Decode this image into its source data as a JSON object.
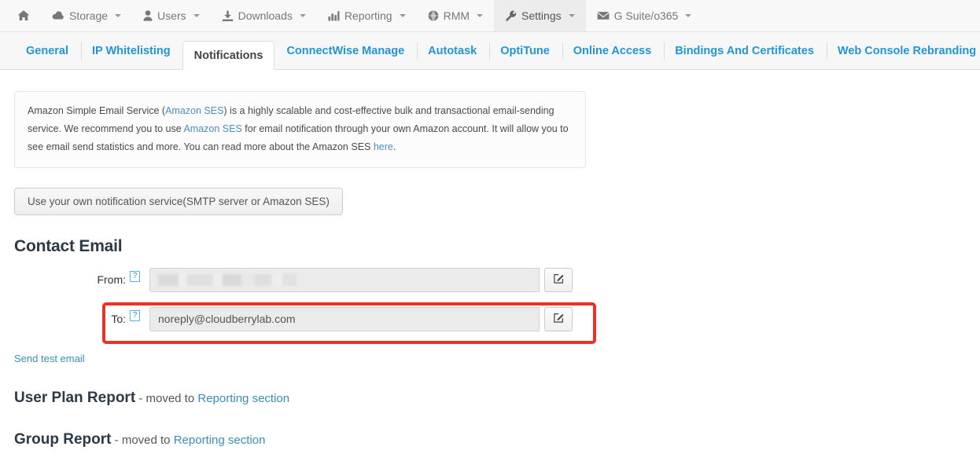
{
  "navbar": {
    "home_icon": "home-icon",
    "items": [
      {
        "label": "Storage",
        "icon": "cloud-icon",
        "caret": true,
        "active": false
      },
      {
        "label": "Users",
        "icon": "user-icon",
        "caret": true,
        "active": false
      },
      {
        "label": "Downloads",
        "icon": "download-icon",
        "caret": true,
        "active": false
      },
      {
        "label": "Reporting",
        "icon": "bar-chart-icon",
        "caret": true,
        "active": false
      },
      {
        "label": "RMM",
        "icon": "globe-icon",
        "caret": true,
        "active": false
      },
      {
        "label": "Settings",
        "icon": "wrench-icon",
        "caret": true,
        "active": true
      },
      {
        "label": "G Suite/o365",
        "icon": "envelope-icon",
        "caret": true,
        "active": false
      }
    ]
  },
  "tabs": [
    {
      "label": "General",
      "active": false
    },
    {
      "label": "IP Whitelisting",
      "active": false
    },
    {
      "label": "Notifications",
      "active": true
    },
    {
      "label": "ConnectWise Manage",
      "active": false
    },
    {
      "label": "Autotask",
      "active": false
    },
    {
      "label": "OptiTune",
      "active": false
    },
    {
      "label": "Online Access",
      "active": false
    },
    {
      "label": "Bindings And Certificates",
      "active": false
    },
    {
      "label": "Web Console Rebranding",
      "active": false
    }
  ],
  "alert": {
    "part1": "Amazon Simple Email Service (",
    "link1": "Amazon SES",
    "part2": ") is a highly scalable and cost-effective bulk and transactional email-sending service. We recommend you to use ",
    "link2": "Amazon SES",
    "part3": " for email notification through your own Amazon account. It will allow you to see email send statistics and more. You can read more about the Amazon SES ",
    "link3": "here",
    "part4": "."
  },
  "own_service_button": "Use your own notification service(SMTP server or Amazon SES)",
  "contact_email": {
    "title": "Contact Email",
    "help_glyph": "?",
    "from": {
      "label": "From:",
      "value": "",
      "placeholder": "",
      "redacted": true,
      "edit_icon": "pencil-square-icon"
    },
    "to": {
      "label": "To:",
      "value": "noreply@cloudberrylab.com",
      "placeholder": "",
      "redacted": false,
      "edit_icon": "pencil-square-icon",
      "highlighted": true
    },
    "send_test_link": "Send test email"
  },
  "reports": [
    {
      "title": "User Plan Report",
      "middle": " - moved to ",
      "link": "Reporting section"
    },
    {
      "title": "Group Report",
      "middle": " - moved to ",
      "link": "Reporting section"
    }
  ],
  "colors": {
    "link_blue": "#2196d6",
    "highlight_red": "#ee3124",
    "navbar_bg": "#f8f8f8",
    "active_nav_bg": "#ececec"
  }
}
